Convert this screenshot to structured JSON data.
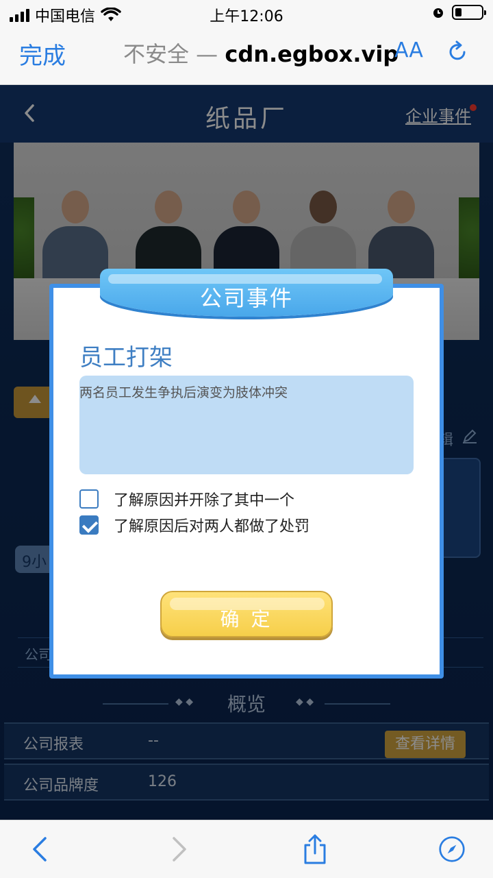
{
  "status_bar": {
    "carrier": "中国电信",
    "time": "上午12:06"
  },
  "browser": {
    "done_label": "完成",
    "security_label": "不安全 —",
    "domain": "cdn.egbox.vip",
    "text_size_label": "AA",
    "icons": [
      "reload-icon",
      "back-arrow-icon",
      "forward-arrow-icon",
      "share-icon",
      "compass-icon"
    ]
  },
  "page": {
    "title": "纸品厂",
    "events_link": "企业事件",
    "edit_label": "辑",
    "time_badge": "9小",
    "company_row_label": "公司",
    "section_title": "概览",
    "overview_rows": [
      {
        "label": "公司报表",
        "value": "--",
        "button": "查看详情"
      },
      {
        "label": "公司品牌度",
        "value": "126"
      }
    ]
  },
  "modal": {
    "header_title": "公司事件",
    "event_name": "员工打架",
    "event_description": "两名员工发生争执后演变为肢体冲突",
    "options": [
      {
        "label": "了解原因并开除了其中一个",
        "checked": false
      },
      {
        "label": "了解原因后对两人都做了处罚",
        "checked": true
      }
    ],
    "confirm_label": "确 定"
  },
  "colors": {
    "accent_blue": "#2a7de1",
    "modal_border": "#3f8fe6",
    "confirm_yellow": "#f6cf4a",
    "page_bg": "#0d2a5a"
  }
}
